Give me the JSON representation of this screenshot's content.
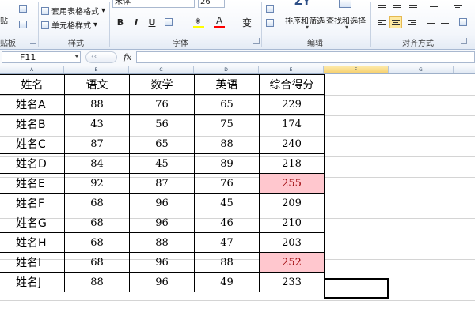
{
  "ribbon": {
    "clipboard": {
      "paste_label": "贴",
      "group_label": "贴板"
    },
    "styles": {
      "table_format_label": "套用表格格式",
      "cell_style_label": "单元格样式",
      "group_label": "样式"
    },
    "font": {
      "font_name": "宋体",
      "font_size": "26",
      "bold": "B",
      "italic": "I",
      "underline": "U",
      "font_color_letter": "A",
      "phonetic_label": "变",
      "group_label": "字体",
      "fill_color": "#ffff00",
      "font_color": "#ff0000"
    },
    "editing": {
      "sort_filter_label": "排序和筛选",
      "find_select_label": "查找和选择",
      "group_label": "编辑"
    },
    "alignment": {
      "group_label": "对齐方式"
    }
  },
  "formula_bar": {
    "name_box": "F11",
    "fx": "fx",
    "formula": ""
  },
  "columns": [
    "A",
    "B",
    "C",
    "D",
    "E",
    "F",
    "G"
  ],
  "selected_column": "F",
  "table": {
    "headers": [
      "姓名",
      "语文",
      "数学",
      "英语",
      "综合得分"
    ],
    "rows": [
      [
        "姓名A",
        "88",
        "76",
        "65",
        "229"
      ],
      [
        "姓名B",
        "43",
        "56",
        "75",
        "174"
      ],
      [
        "姓名C",
        "87",
        "65",
        "88",
        "240"
      ],
      [
        "姓名D",
        "84",
        "45",
        "89",
        "218"
      ],
      [
        "姓名E",
        "92",
        "87",
        "76",
        "255"
      ],
      [
        "姓名F",
        "68",
        "96",
        "45",
        "209"
      ],
      [
        "姓名G",
        "68",
        "96",
        "46",
        "210"
      ],
      [
        "姓名H",
        "68",
        "88",
        "47",
        "203"
      ],
      [
        "姓名I",
        "68",
        "96",
        "88",
        "252"
      ],
      [
        "姓名J",
        "88",
        "96",
        "49",
        "233"
      ]
    ]
  },
  "highlight": {
    "fill": "#ffc7ce",
    "text": "#9c0006"
  }
}
